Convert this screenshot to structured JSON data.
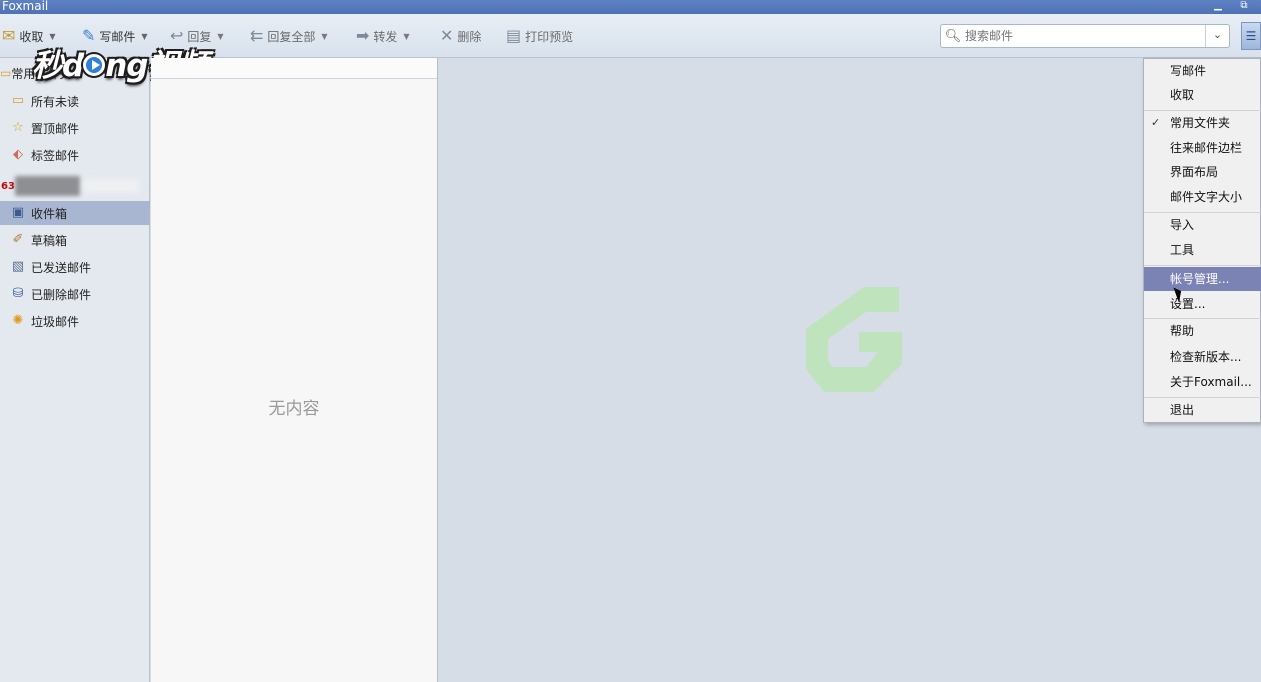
{
  "window": {
    "title": "Foxmail",
    "minimize_symbol": "▁",
    "restore_symbol": "⧉"
  },
  "toolbar": {
    "receive_label": "收取",
    "compose_label": "写邮件",
    "reply_label": "回复",
    "reply_all_label": "回复全部",
    "forward_label": "转发",
    "delete_label": "删除",
    "print_preview_label": "打印预览"
  },
  "search": {
    "placeholder": "搜索邮件"
  },
  "sidebar": {
    "group_label": "常用文件夹",
    "items": [
      {
        "label": "所有未读",
        "icon": "folder-icon"
      },
      {
        "label": "置顶邮件",
        "icon": "star-icon"
      },
      {
        "label": "标签邮件",
        "icon": "tag-icon"
      }
    ],
    "account": {
      "badge": "63"
    },
    "folders": [
      {
        "label": "收件箱",
        "icon": "inbox-icon"
      },
      {
        "label": "草稿箱",
        "icon": "draft-icon"
      },
      {
        "label": "已发送邮件",
        "icon": "sent-icon"
      },
      {
        "label": "已删除邮件",
        "icon": "trash-icon"
      },
      {
        "label": "垃圾邮件",
        "icon": "junk-icon"
      }
    ]
  },
  "watermark": {
    "part1": "秒d",
    "part2": "ng视频"
  },
  "maillist": {
    "empty_text": "无内容"
  },
  "menu": {
    "items": [
      "写邮件",
      "收取",
      "常用文件夹",
      "往来邮件边栏",
      "界面布局",
      "邮件文字大小",
      "导入",
      "工具",
      "帐号管理...",
      "设置...",
      "帮助",
      "检查新版本...",
      "关于Foxmail...",
      "退出"
    ],
    "checked_item": "常用文件夹",
    "highlighted_item": "帐号管理..."
  },
  "colors": {
    "accent": "#7b83b5",
    "titlebar": "#5f82c4",
    "logo": "#bfe3bd"
  }
}
